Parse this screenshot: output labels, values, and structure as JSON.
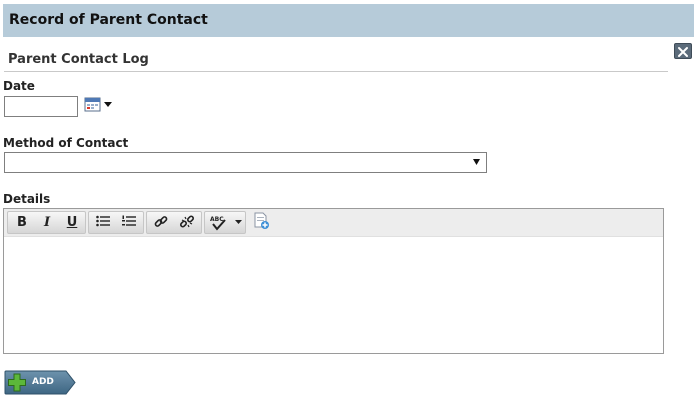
{
  "header": {
    "title": "Record of Parent Contact"
  },
  "section": {
    "title": "Parent Contact Log"
  },
  "date": {
    "label": "Date",
    "value": ""
  },
  "method": {
    "label": "Method of Contact",
    "value": ""
  },
  "details": {
    "label": "Details"
  },
  "toolbar": {
    "bold": "B",
    "italic": "I",
    "underline": "U",
    "spell": "ABC"
  },
  "actions": {
    "add_label": "ADD"
  },
  "colors": {
    "titlebar": "#b6cbd9",
    "close": "#5b6b7a",
    "add_button": "#4d7691",
    "add_plus": "#5cb83a"
  }
}
